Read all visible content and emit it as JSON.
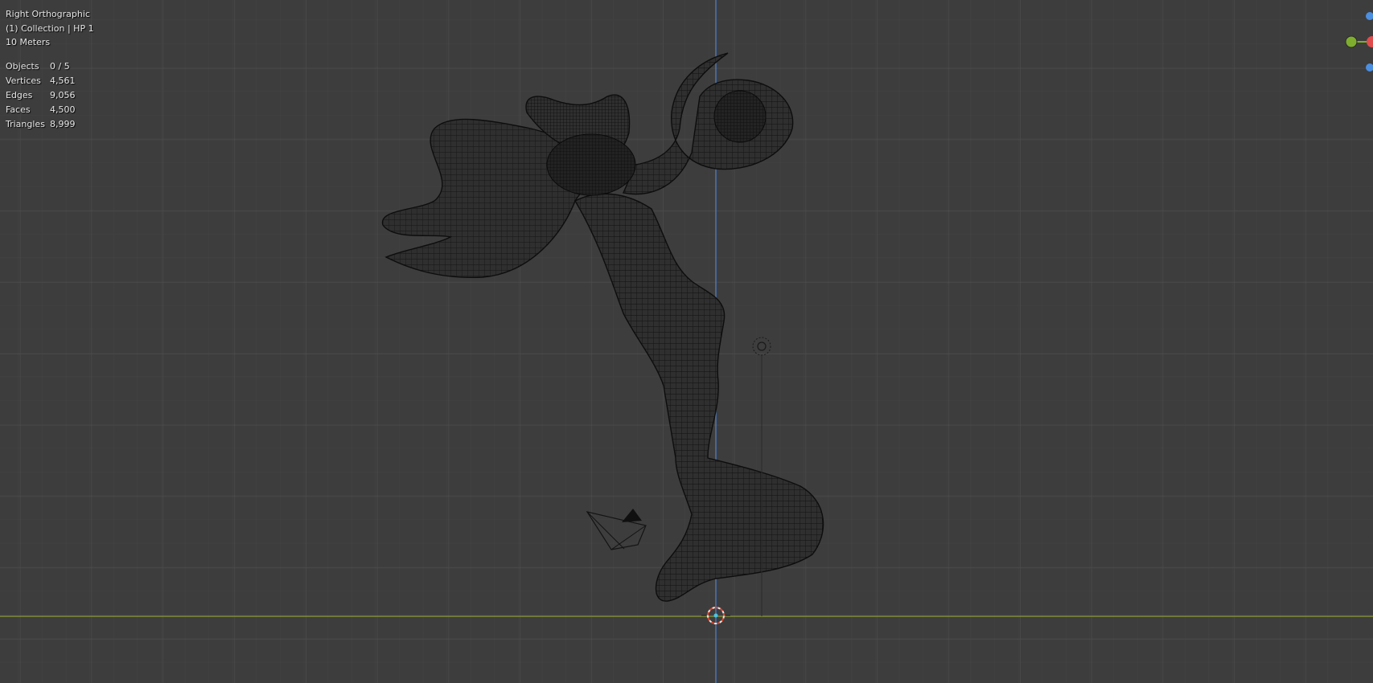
{
  "viewport": {
    "view_name": "Right Orthographic",
    "collection_label": "(1) Collection | HP 1",
    "scale_label": "10 Meters"
  },
  "stats": [
    {
      "label": "Objects",
      "value": "0 / 5"
    },
    {
      "label": "Vertices",
      "value": "4,561"
    },
    {
      "label": "Edges",
      "value": "9,056"
    },
    {
      "label": "Faces",
      "value": "4,500"
    },
    {
      "label": "Triangles",
      "value": "8,999"
    }
  ],
  "colors": {
    "background": "#3d3d3d",
    "grid_minor": "#464646",
    "grid_major": "#4f4f4f",
    "axis_z": "#4a7ec9",
    "axis_y": "#8f9b3a",
    "mesh_fill": "#2e2e2e",
    "wire": "#111111",
    "gizmo_x": "#e04b4b",
    "gizmo_y": "#7fae2e",
    "gizmo_z": "#4c8ee0"
  },
  "icons": [
    "camera-icon",
    "light-icon",
    "3d-cursor-icon",
    "navigation-gizmo-icon"
  ]
}
